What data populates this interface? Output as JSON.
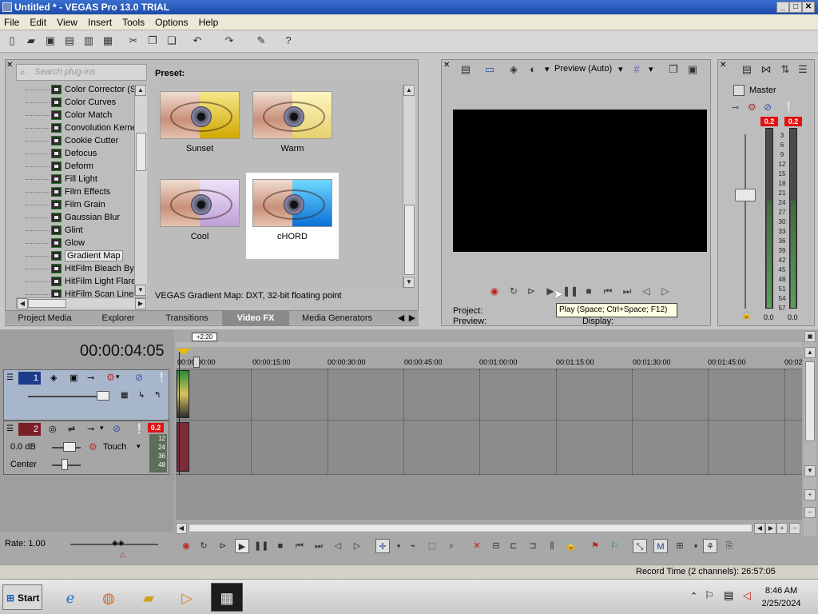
{
  "window": {
    "title": "Untitled * - VEGAS Pro 13.0 TRIAL",
    "min": "_",
    "max": "□",
    "close": "✕"
  },
  "menu": [
    "File",
    "Edit",
    "View",
    "Insert",
    "Tools",
    "Options",
    "Help"
  ],
  "plugins": {
    "search_placeholder": "Search plug-ins",
    "items": [
      "Color Corrector (S",
      "Color Curves",
      "Color Match",
      "Convolution Kerne",
      "Cookie Cutter",
      "Defocus",
      "Deform",
      "Fill Light",
      "Film Effects",
      "Film Grain",
      "Gaussian Blur",
      "Glint",
      "Glow",
      "Gradient Map",
      "HitFilm Bleach Byp",
      "HitFilm Light Flares",
      "HitFilm Scan Lines"
    ],
    "selected": "Gradient Map"
  },
  "presets": {
    "label": "Preset:",
    "items": [
      {
        "name": "Sunset",
        "tint": "#e6c000"
      },
      {
        "name": "Warm",
        "tint": "#f2e28a"
      },
      {
        "name": "Cool",
        "tint": "#d0b4e8"
      },
      {
        "name": "cHORD",
        "tint": "#1a9ee8"
      }
    ],
    "selected": "cHORD",
    "description": "VEGAS Gradient Map: DXT, 32-bit floating point"
  },
  "tabs": [
    "Project Media",
    "Explorer",
    "Transitions",
    "Video FX",
    "Media Generators"
  ],
  "active_tab": "Video FX",
  "preview": {
    "mode": "Preview (Auto)",
    "project_label": "Project:",
    "preview_label": "Preview:",
    "display_label": "Display:",
    "tooltip": "Play (Space; Ctrl+Space; F12)"
  },
  "mixer": {
    "title": "Master",
    "left_peak": "0.2",
    "right_peak": "0.2",
    "left_val": "0.0",
    "right_val": "0.0",
    "scale": [
      "3",
      "6",
      "9",
      "12",
      "15",
      "18",
      "21",
      "24",
      "27",
      "30",
      "33",
      "36",
      "39",
      "42",
      "45",
      "48",
      "51",
      "54",
      "57"
    ]
  },
  "timeline": {
    "time": "00:00:04:05",
    "marker": "+2:20",
    "ruler": [
      "00:00:00:00",
      "00:00:15:00",
      "00:00:30:00",
      "00:00:45:00",
      "00:01:00:00",
      "00:01:15:00",
      "00:01:30:00",
      "00:01:45:00",
      "00:02"
    ],
    "track1": {
      "num": "1"
    },
    "track2": {
      "num": "2",
      "peak": "0.2",
      "volume": "0.0 dB",
      "mode": "Touch",
      "pan": "Center",
      "meter": [
        "12",
        "24",
        "36",
        "48"
      ]
    },
    "rate": "Rate: 1.00"
  },
  "status": {
    "record_time": "Record Time (2 channels): 26:57:05"
  },
  "taskbar": {
    "start": "Start",
    "time": "8:46 AM",
    "date": "2/25/2024"
  }
}
